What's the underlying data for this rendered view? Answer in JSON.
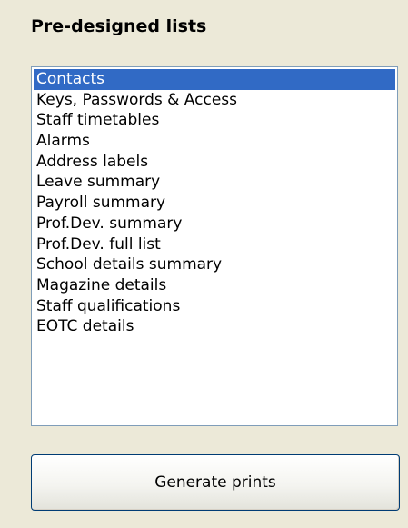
{
  "panel": {
    "title": "Pre-designed lists"
  },
  "list": {
    "selected_index": 0,
    "items": [
      "Contacts",
      "Keys, Passwords & Access",
      "Staff timetables",
      "Alarms",
      "Address labels",
      "Leave summary",
      "Payroll summary",
      "Prof.Dev. summary",
      "Prof.Dev. full list",
      "School details summary",
      "Magazine details",
      "Staff qualifications",
      "EOTC details"
    ]
  },
  "actions": {
    "generate_label": "Generate prints"
  },
  "colors": {
    "background": "#ece9d8",
    "selection": "#316ac5",
    "list_border": "#7f9db9"
  }
}
